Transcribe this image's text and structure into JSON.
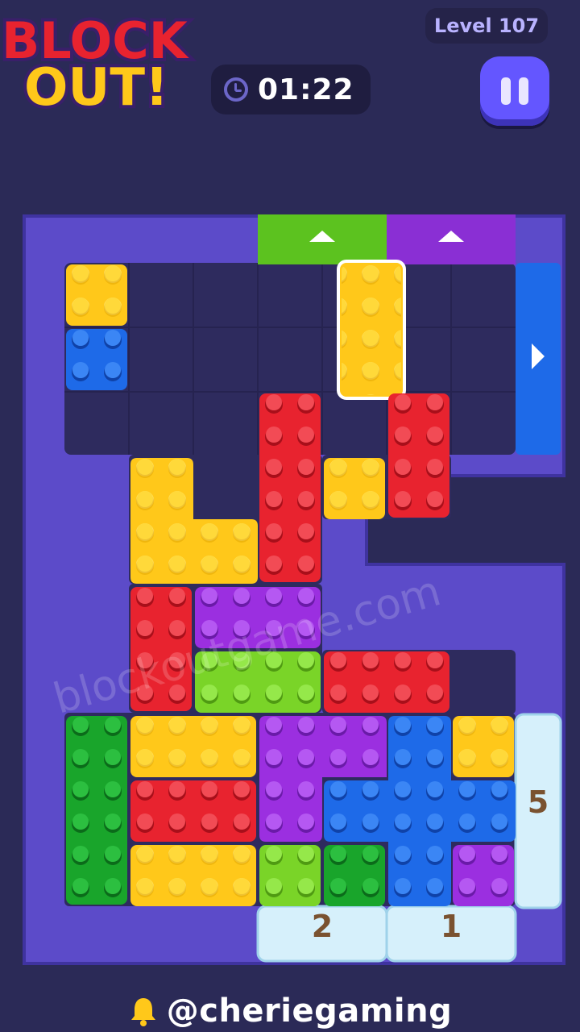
{
  "header": {
    "logo_line1": "BLOCK",
    "logo_line2": "OUT!",
    "level": "Level 107",
    "timer": "01:22"
  },
  "colors": {
    "background": "#2b2a57",
    "board": "#5c4bc9",
    "cell": "#2e2b5e",
    "yellow": "#ffc81a",
    "red": "#e8232f",
    "blue": "#1e6ae8",
    "green": "#19a52b",
    "lime": "#7ad428",
    "purple": "#9b2fe0"
  },
  "gates": {
    "top_green": {
      "color": "lime",
      "direction": "up"
    },
    "top_purple": {
      "color": "purple",
      "direction": "up"
    },
    "right_blue": {
      "color": "blue",
      "direction": "right"
    },
    "ice_right": {
      "label": "5"
    },
    "ice_bottom_left": {
      "label": "2"
    },
    "ice_bottom_right": {
      "label": "1"
    }
  },
  "watermark": "blockoutgame.com",
  "footer": {
    "handle": "@cheriegaming"
  }
}
